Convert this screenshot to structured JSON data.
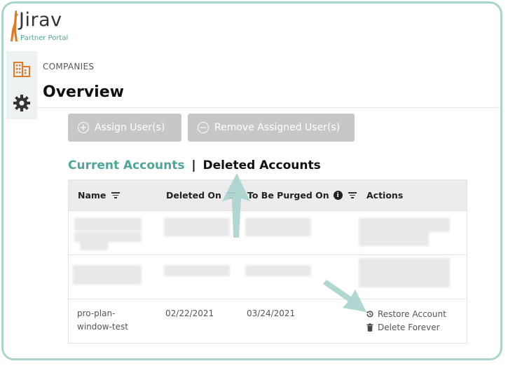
{
  "logo": {
    "name": "Jirav",
    "subtitle": "Partner Portal"
  },
  "sidebar": {
    "items": [
      {
        "icon": "building-icon"
      },
      {
        "icon": "gear-icon"
      }
    ]
  },
  "breadcrumb": "COMPANIES",
  "page_title": "Overview",
  "toolbar": {
    "assign_label": "Assign User(s)",
    "remove_label": "Remove Assigned User(s)"
  },
  "tabs": {
    "current": "Current Accounts",
    "separator": "|",
    "deleted": "Deleted Accounts"
  },
  "table": {
    "columns": [
      {
        "label": "Name",
        "filter": true
      },
      {
        "label": "Deleted On",
        "filter": true
      },
      {
        "label": "To Be Purged On",
        "info": true,
        "filter": true
      },
      {
        "label": "Actions"
      }
    ],
    "rows": [
      {
        "name": "pro-plan-window-test",
        "deleted_on": "02/22/2021",
        "purged_on": "03/24/2021",
        "actions": {
          "restore": "Restore Account",
          "delete": "Delete Forever"
        }
      }
    ]
  },
  "colors": {
    "accent": "#4ea696",
    "frame": "#a9d4cd",
    "logo_orange": "#e07b24",
    "button_disabled": "#c7c7c7",
    "arrow": "#a9d4cd"
  }
}
